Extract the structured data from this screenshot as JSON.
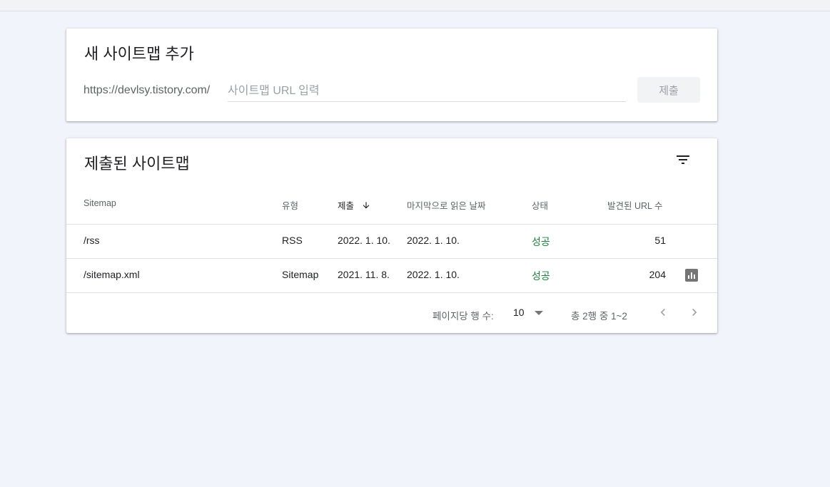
{
  "add_card": {
    "title": "새 사이트맵 추가",
    "url_prefix": "https://devlsy.tistory.com/",
    "input_placeholder": "사이트맵 URL 입력",
    "input_value": "",
    "submit_label": "제출"
  },
  "list_card": {
    "title": "제출된 사이트맵",
    "columns": [
      "Sitemap",
      "유형",
      "제출",
      "마지막으로 읽은 날짜",
      "상태",
      "발견된 URL 수"
    ],
    "sort_column": "제출",
    "sort_direction": "descending",
    "rows": [
      {
        "sitemap": "/rss",
        "type": "RSS",
        "submitted": "2022. 1. 10.",
        "last_read": "2022. 1. 10.",
        "status": "성공",
        "urls": "51"
      },
      {
        "sitemap": "/sitemap.xml",
        "type": "Sitemap",
        "submitted": "2021. 11. 8.",
        "last_read": "2022. 1. 10.",
        "status": "성공",
        "urls": "204"
      }
    ],
    "footer": {
      "rows_per_page_label": "페이지당 행 수:",
      "rows_per_page_value": "10",
      "range_text": "총 2행 중 1~2"
    }
  },
  "colors": {
    "background": "#f1f4fb",
    "success": "#188038",
    "muted": "#5f6368"
  },
  "icons": [
    "filter-icon",
    "arrow-down-icon",
    "bar-chart-icon",
    "chevron-down-icon",
    "chevron-left-icon",
    "chevron-right-icon"
  ]
}
